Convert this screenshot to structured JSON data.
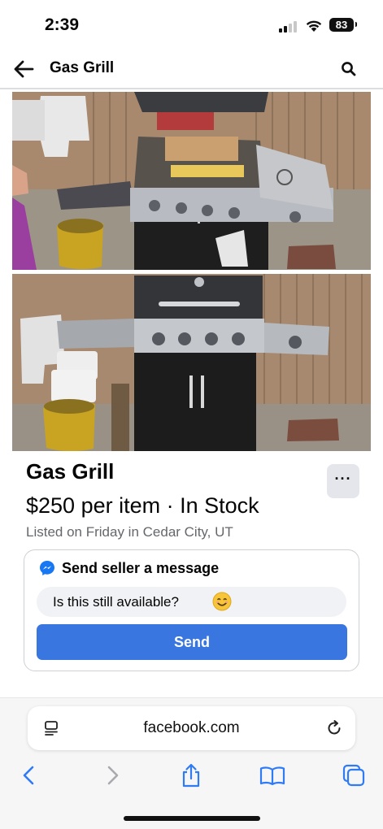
{
  "status_bar": {
    "time": "2:39",
    "battery": "83"
  },
  "header": {
    "title": "Gas Grill",
    "back_icon": "arrow-left-icon",
    "search_icon": "search-icon"
  },
  "photos": [
    {
      "description_icon": "grill-photo"
    },
    {
      "description_icon": "grill-photo"
    }
  ],
  "listing": {
    "title": "Gas Grill",
    "price_line": "$250 per item · In Stock",
    "listed_line": "Listed on Friday in Cedar City, UT",
    "more_label": "···"
  },
  "message": {
    "header": "Send seller a message",
    "input_value": "Is this still available?",
    "send_label": "Send"
  },
  "browser": {
    "url": "facebook.com"
  },
  "colors": {
    "accent": "#3a76e0",
    "messenger": "#1877f2",
    "safari_blue": "#2f7bf6",
    "secondary_text": "#65676b"
  }
}
